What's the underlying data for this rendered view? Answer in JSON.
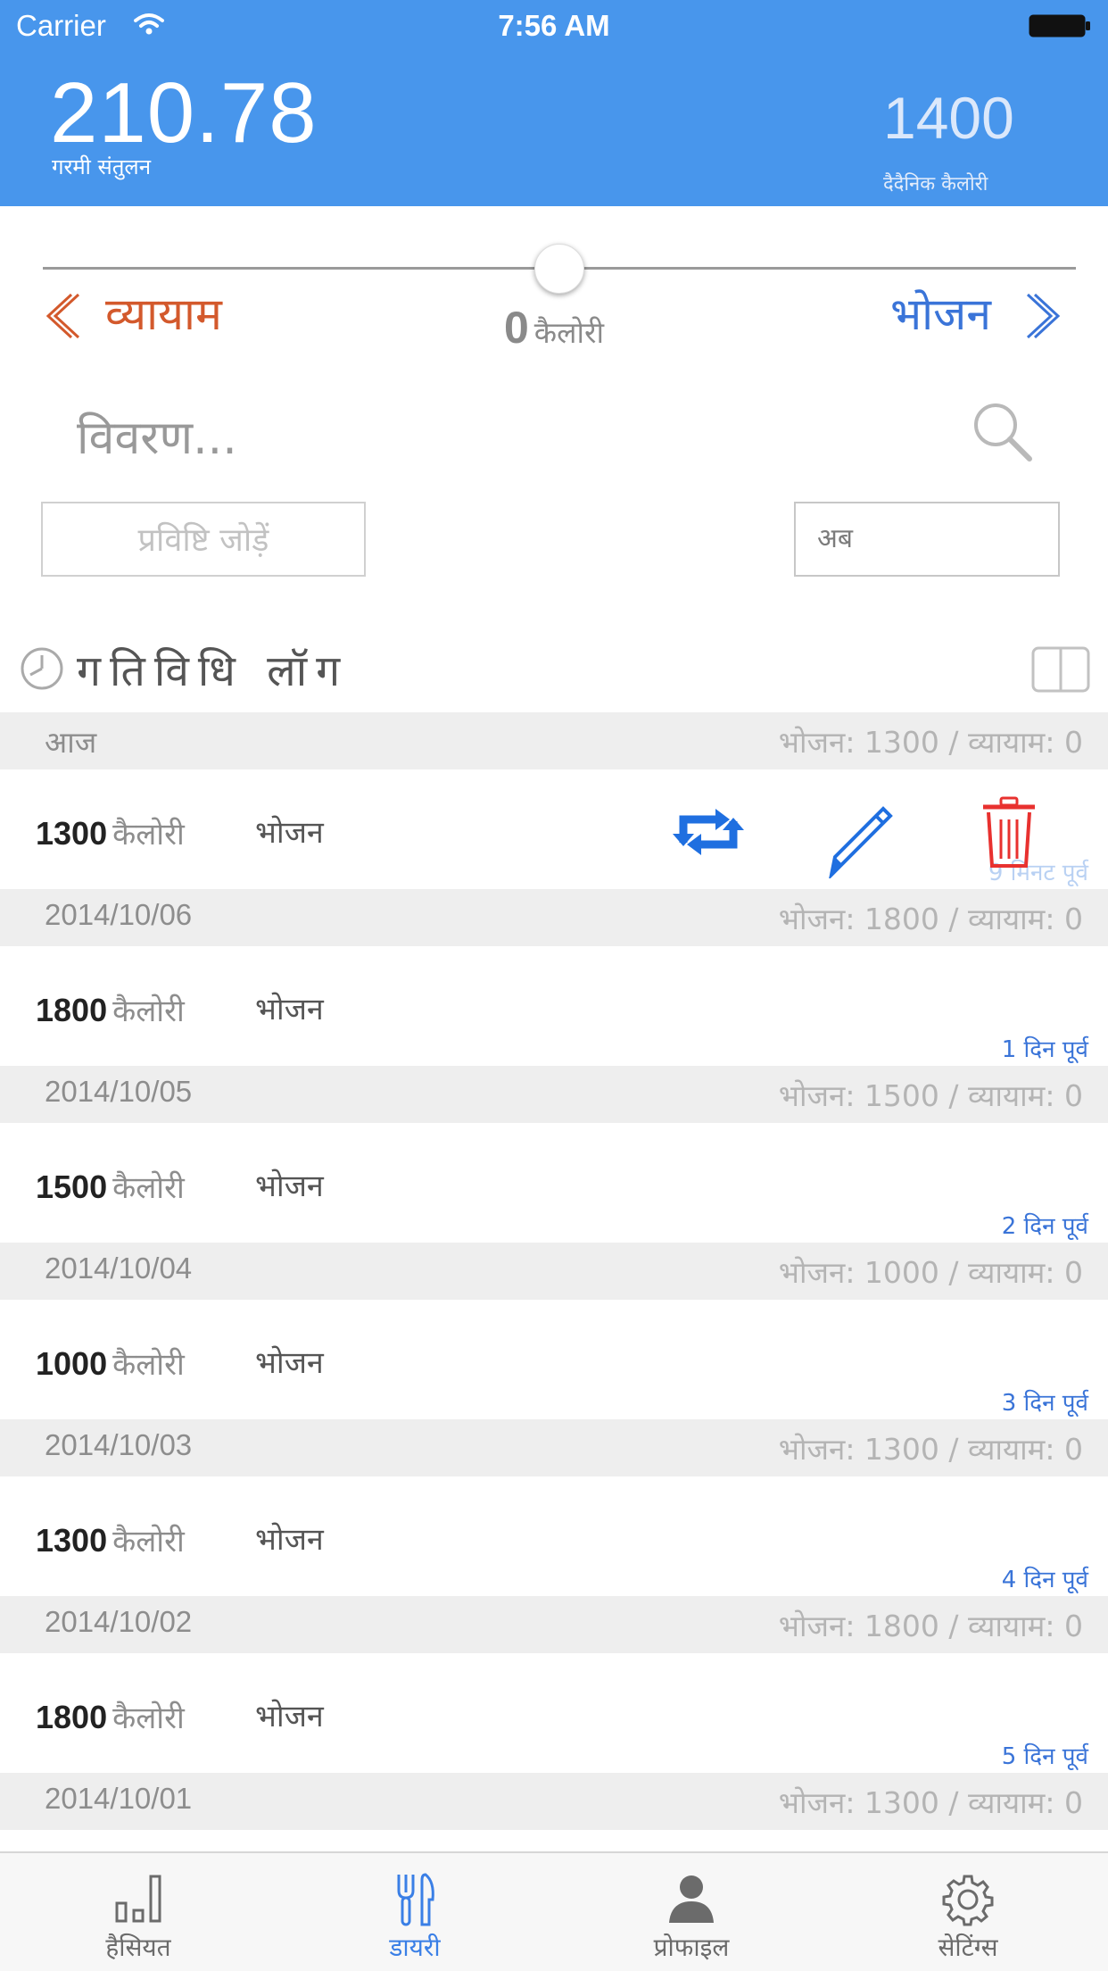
{
  "status_bar": {
    "carrier": "Carrier",
    "time": "7:56 AM"
  },
  "header": {
    "heat_balance_value": "210.78",
    "heat_balance_label": "गरमी संतुलन",
    "daily_calories_value": "1400",
    "daily_calories_label": "दैदैनिक कैलोरी"
  },
  "entry": {
    "slider_level": 0.5,
    "exercise_label": "व्यायाम",
    "food_label": "भोजन",
    "calorie_value": "0",
    "calorie_unit": "कैलोरी",
    "description_placeholder": "विवरण...",
    "add_entry_label": "प्रविष्टि जोड़ें",
    "time_value": "अब"
  },
  "log": {
    "title": "गतिविधि लॉग",
    "groups": [
      {
        "date": "आज",
        "summary": "भोजन: 1300 / व्यायाम: 0",
        "calories": "1300",
        "unit": "कैलोरी",
        "type": "भोजन",
        "ago": "9 मिनट पूर्व"
      },
      {
        "date": "2014/10/06",
        "summary": "भोजन: 1800 / व्यायाम: 0",
        "calories": "1800",
        "unit": "कैलोरी",
        "type": "भोजन",
        "ago": "1 दिन पूर्व"
      },
      {
        "date": "2014/10/05",
        "summary": "भोजन: 1500 / व्यायाम: 0",
        "calories": "1500",
        "unit": "कैलोरी",
        "type": "भोजन",
        "ago": "2 दिन पूर्व"
      },
      {
        "date": "2014/10/04",
        "summary": "भोजन: 1000 / व्यायाम: 0",
        "calories": "1000",
        "unit": "कैलोरी",
        "type": "भोजन",
        "ago": "3 दिन पूर्व"
      },
      {
        "date": "2014/10/03",
        "summary": "भोजन: 1300 / व्यायाम: 0",
        "calories": "1300",
        "unit": "कैलोरी",
        "type": "भोजन",
        "ago": "4 दिन पूर्व"
      },
      {
        "date": "2014/10/02",
        "summary": "भोजन: 1800 / व्यायाम: 0",
        "calories": "1800",
        "unit": "कैलोरी",
        "type": "भोजन",
        "ago": "5 दिन पूर्व"
      }
    ],
    "last_section": {
      "date": "2014/10/01",
      "summary": "भोजन: 1300 / व्यायाम: 0"
    }
  },
  "tabs": [
    {
      "label": "हैसियत",
      "icon": "bar-chart-icon"
    },
    {
      "label": "डायरी",
      "icon": "fork-knife-icon"
    },
    {
      "label": "प्रोफाइल",
      "icon": "person-icon"
    },
    {
      "label": "सेटिंग्स",
      "icon": "gear-icon"
    }
  ],
  "colors": {
    "header_bg": "#4896ec",
    "exercise": "#d3592c",
    "food": "#3a74d8",
    "delete": "#e8312f",
    "active_tab": "#3a7fe6"
  }
}
